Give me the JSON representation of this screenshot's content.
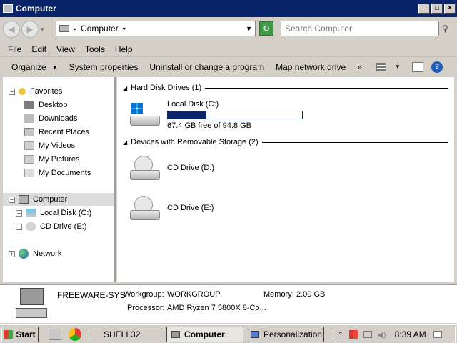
{
  "window": {
    "title": "Computer"
  },
  "nav": {
    "address": "Computer",
    "search_placeholder": "Search Computer"
  },
  "menu": [
    "File",
    "Edit",
    "View",
    "Tools",
    "Help"
  ],
  "toolbar": {
    "organize": "Organize",
    "system_properties": "System properties",
    "uninstall": "Uninstall or change a program",
    "map_drive": "Map network drive",
    "more": "»"
  },
  "sidebar": {
    "favorites": "Favorites",
    "fav_items": [
      "Desktop",
      "Downloads",
      "Recent Places",
      "My Videos",
      "My Pictures",
      "My Documents"
    ],
    "computer": "Computer",
    "computer_items": [
      "Local Disk (C:)",
      "CD Drive (E:)"
    ],
    "network": "Network"
  },
  "main": {
    "hdd_section": "Hard Disk Drives (1)",
    "local_disk": {
      "name": "Local Disk (C:)",
      "free_text": "67.4 GB free of 94.8 GB",
      "used_fraction": 0.289
    },
    "removable_section": "Devices with Removable Storage (2)",
    "cd_d": "CD Drive (D:)",
    "cd_e": "CD Drive (E:)"
  },
  "details": {
    "computer_name": "FREEWARE-SYS",
    "workgroup_label": "Workgroup:",
    "workgroup_value": "WORKGROUP",
    "memory_label": "Memory:",
    "memory_value": "2.00 GB",
    "processor_label": "Processor:",
    "processor_value": "AMD Ryzen 7 5800X 8-Co..."
  },
  "taskbar": {
    "start": "Start",
    "shell": "SHELL32",
    "computer": "Computer",
    "personalization": "Personalization",
    "time": "8:39 AM"
  },
  "colors": {
    "titlebar": "#0a246a",
    "progress": "#0a246a"
  }
}
